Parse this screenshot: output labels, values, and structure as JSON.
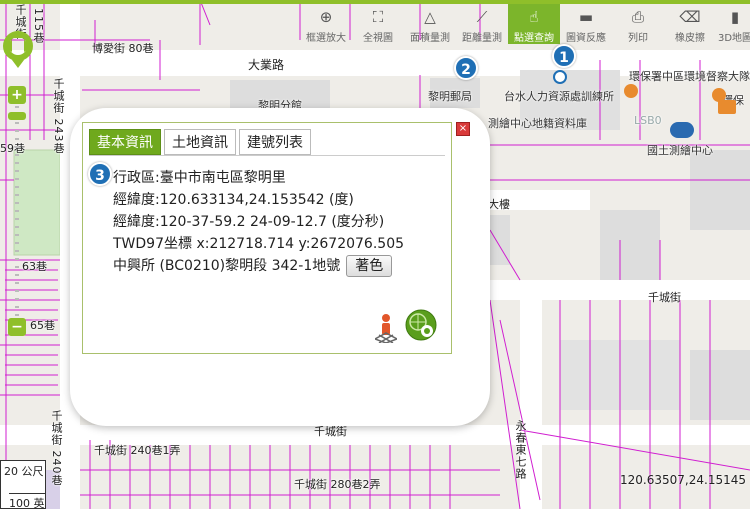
{
  "toolbar": {
    "tools": [
      {
        "label": "框選放大",
        "icon": "zoom-box-icon"
      },
      {
        "label": "全視圖",
        "icon": "full-extent-icon"
      },
      {
        "label": "面積量測",
        "icon": "area-measure-icon"
      },
      {
        "label": "距離量測",
        "icon": "distance-measure-icon"
      },
      {
        "label": "點選查詢",
        "icon": "point-query-icon"
      },
      {
        "label": "圖資反應",
        "icon": "feedback-icon"
      },
      {
        "label": "列印",
        "icon": "print-icon"
      },
      {
        "label": "橡皮擦",
        "icon": "eraser-icon"
      },
      {
        "label": "3D地圖",
        "icon": "3d-map-icon"
      }
    ],
    "active_index": 4,
    "accent_color": "#7cb52b"
  },
  "popup": {
    "tabs": [
      "基本資訊",
      "土地資訊",
      "建號列表"
    ],
    "active_tab": 0,
    "lines": {
      "district": "行政區:臺中市南屯區黎明里",
      "lonlat_deg": "經緯度:120.633134,24.153542 (度)",
      "lonlat_dms": "經緯度:120-37-59.2 24-09-12.7 (度分秒)",
      "twd97": "TWD97坐標 x:212718.714 y:2672076.505",
      "parcel": "中興所 (BC0210)黎明段 342-1地號"
    },
    "color_button": "著色",
    "close_symbol": "×"
  },
  "badges": [
    "1",
    "2",
    "3"
  ],
  "map": {
    "labels": {
      "l1": "115巷",
      "l2": "千城街",
      "l3": "博愛街 80巷",
      "l4": "大業路",
      "l5": "黎明分館",
      "l6": "黎明郵局",
      "l7": "台水人力資源處訓練所",
      "l8": "環保署中區環境督察大隊",
      "l9": "環保",
      "l10": "測繪中心地籍資料庫",
      "l11": "LSB0",
      "l12": "國土測繪中心",
      "l13": "千城街 243巷",
      "l14": "59巷",
      "l15": "63巷",
      "l16": "65巷",
      "l17": "大樓",
      "l18": "千城街",
      "l19": "千城街 240巷",
      "l20": "千城街 240巷1弄",
      "l21": "永春東七路",
      "l22": "千城街 280巷2弄",
      "l23": "千城街"
    },
    "coord_readout": "120.63507,24.15145",
    "scale": {
      "top": "20 公尺",
      "bottom": "100 英"
    }
  }
}
